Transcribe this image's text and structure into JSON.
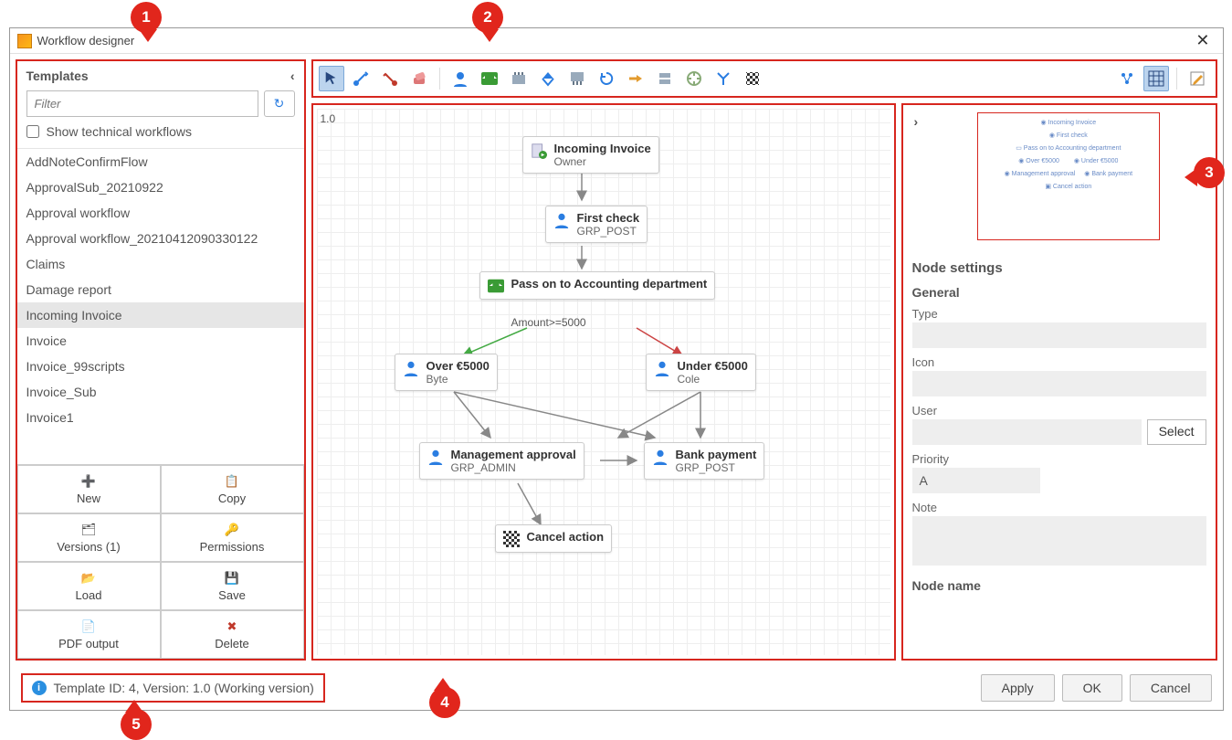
{
  "window": {
    "title": "Workflow designer"
  },
  "sidebar": {
    "header": "Templates",
    "filter_placeholder": "Filter",
    "show_technical": "Show technical workflows",
    "items": [
      "AddNoteConfirmFlow",
      "ApprovalSub_20210922",
      "Approval workflow",
      "Approval workflow_20210412090330122",
      "Claims",
      "Damage report",
      "Incoming Invoice",
      "Invoice",
      "Invoice_99scripts",
      "Invoice_Sub",
      "Invoice1"
    ],
    "active_index": 6,
    "buttons": {
      "new": "New",
      "copy": "Copy",
      "versions": "Versions (1)",
      "permissions": "Permissions",
      "load": "Load",
      "save": "Save",
      "pdf": "PDF output",
      "delete": "Delete"
    }
  },
  "toolbar": {
    "select": "select",
    "successor": "successor",
    "predecessor": "predecessor",
    "eraser": "eraser",
    "person": "person-node",
    "decision": "decision-node",
    "collect": "collect-node",
    "distribute": "distribute-node",
    "split": "split-node",
    "cycle": "cycle-node",
    "flow": "flow-node",
    "server": "server-node",
    "plugin": "plugin-node",
    "end": "end-node",
    "minimap": "minimap-toggle",
    "grid": "grid-toggle",
    "edit": "edit-properties"
  },
  "canvas": {
    "version_label": "1.0",
    "nodes": {
      "start": {
        "title": "Incoming Invoice",
        "sub": "Owner"
      },
      "first": {
        "title": "First check",
        "sub": "GRP_POST"
      },
      "pass": {
        "title": "Pass on to Accounting department"
      },
      "cond": {
        "label": "Amount>=5000"
      },
      "over": {
        "title": "Over €5000",
        "sub": "Byte"
      },
      "under": {
        "title": "Under €5000",
        "sub": "Cole"
      },
      "mgmt": {
        "title": "Management approval",
        "sub": "GRP_ADMIN"
      },
      "bank": {
        "title": "Bank payment",
        "sub": "GRP_POST"
      },
      "cancel": {
        "title": "Cancel action"
      }
    }
  },
  "settings": {
    "panel_title": "Node settings",
    "general": "General",
    "type": "Type",
    "icon": "Icon",
    "user": "User",
    "select": "Select",
    "priority": "Priority",
    "priority_value": "A",
    "note": "Note",
    "node_name": "Node name"
  },
  "footer": {
    "status": "Template ID: 4, Version: 1.0 (Working version)",
    "apply": "Apply",
    "ok": "OK",
    "cancel": "Cancel"
  },
  "pins": {
    "1": "1",
    "2": "2",
    "3": "3",
    "4": "4",
    "5": "5"
  }
}
